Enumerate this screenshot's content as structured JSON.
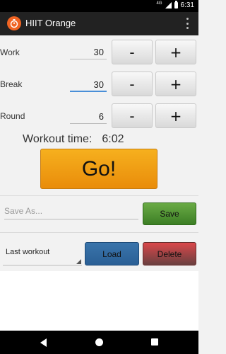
{
  "status_bar": {
    "network": "4G",
    "time": "6:31"
  },
  "app_bar": {
    "title": "HIIT Orange",
    "icon": "timer-icon",
    "menu_icon": "overflow-menu-icon"
  },
  "rows": [
    {
      "label": "Work",
      "value": "30",
      "minus": "-",
      "plus": "+"
    },
    {
      "label": "Break",
      "value": "30",
      "minus": "-",
      "plus": "+"
    },
    {
      "label": "Round",
      "value": "6",
      "minus": "-",
      "plus": "+"
    }
  ],
  "workout": {
    "label": "Workout time:",
    "value": "6:02"
  },
  "go_button": "Go!",
  "save": {
    "placeholder": "Save As...",
    "button": "Save"
  },
  "load": {
    "selected": "Last workout",
    "load_button": "Load",
    "delete_button": "Delete"
  },
  "colors": {
    "go": "#f0a015",
    "save": "#4f9531",
    "load": "#3069a0",
    "delete": "#b04446",
    "accent": "#f06423"
  }
}
